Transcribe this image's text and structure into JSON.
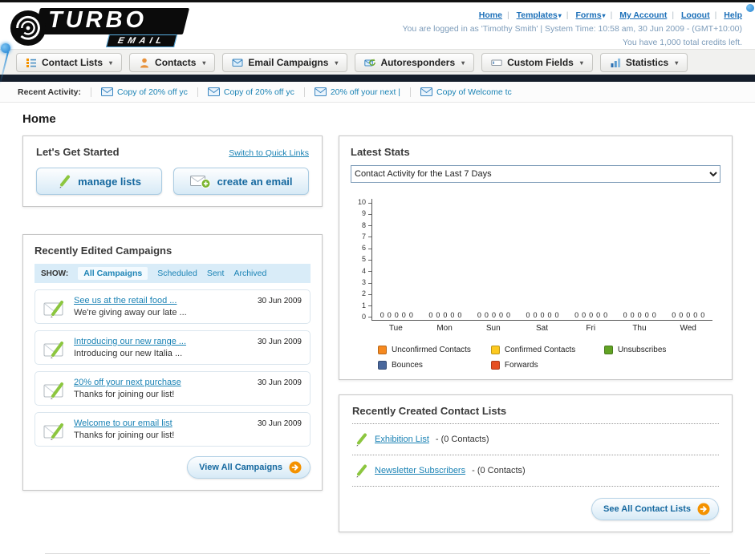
{
  "header": {
    "logo_word1": "TURBO",
    "logo_word2": "EMAIL",
    "links": {
      "home": "Home",
      "templates": "Templates",
      "forms": "Forms",
      "my_account": "My Account",
      "logout": "Logout",
      "help": "Help"
    },
    "login_info": "You are logged in as 'Timothy Smith' | System Time: 10:58 am, 30 Jun 2009 - (GMT+10:00)",
    "credits": "You have 1,000 total credits left."
  },
  "nav": {
    "tabs": [
      {
        "label": "Contact Lists"
      },
      {
        "label": "Contacts"
      },
      {
        "label": "Email Campaigns"
      },
      {
        "label": "Autoresponders"
      },
      {
        "label": "Custom Fields"
      },
      {
        "label": "Statistics"
      }
    ]
  },
  "recent_activity": {
    "label": "Recent Activity:",
    "items": [
      {
        "text": "Copy of 20% off yc"
      },
      {
        "text": "Copy of 20% off yc"
      },
      {
        "text": "20% off your next |"
      },
      {
        "text": "Copy of Welcome tc"
      }
    ]
  },
  "page_title": "Home",
  "get_started": {
    "title": "Let's Get Started",
    "switch_link": "Switch to Quick Links",
    "manage_lists": "manage lists",
    "create_email": "create an email"
  },
  "campaigns": {
    "title": "Recently Edited Campaigns",
    "show_label": "SHOW:",
    "filters": [
      {
        "label": "All Campaigns"
      },
      {
        "label": "Scheduled"
      },
      {
        "label": "Sent"
      },
      {
        "label": "Archived"
      }
    ],
    "items": [
      {
        "title": "See us at the retail food ...",
        "subtitle": "We're giving away our late ...",
        "date": "30 Jun 2009"
      },
      {
        "title": "Introducing our new range ...",
        "subtitle": "Introducing our new Italia ...",
        "date": "30 Jun 2009"
      },
      {
        "title": "20% off your next purchase",
        "subtitle": "Thanks for joining our list!",
        "date": "30 Jun 2009"
      },
      {
        "title": "Welcome to our email list",
        "subtitle": "Thanks for joining our list!",
        "date": "30 Jun 2009"
      }
    ],
    "view_all_label": "View All Campaigns"
  },
  "latest_stats": {
    "title": "Latest Stats",
    "selected_option": "Contact Activity for the Last 7 Days",
    "chart_data": {
      "type": "bar",
      "title": "Contact Activity for the Last 7 Days",
      "categories": [
        "Tue",
        "Mon",
        "Sun",
        "Sat",
        "Fri",
        "Thu",
        "Wed"
      ],
      "series": [
        {
          "name": "Unconfirmed Contacts",
          "color": "#f6891f",
          "values": [
            0,
            0,
            0,
            0,
            0,
            0,
            0
          ]
        },
        {
          "name": "Confirmed Contacts",
          "color": "#fdc91f",
          "values": [
            0,
            0,
            0,
            0,
            0,
            0,
            0
          ]
        },
        {
          "name": "Unsubscribes",
          "color": "#61a324",
          "values": [
            0,
            0,
            0,
            0,
            0,
            0,
            0
          ]
        },
        {
          "name": "Bounces",
          "color": "#49679c",
          "values": [
            0,
            0,
            0,
            0,
            0,
            0,
            0
          ]
        },
        {
          "name": "Forwards",
          "color": "#e64f22",
          "values": [
            0,
            0,
            0,
            0,
            0,
            0,
            0
          ]
        }
      ],
      "ylim": [
        0,
        10
      ],
      "grid": false,
      "legend_position": "bottom"
    }
  },
  "contact_lists": {
    "title": "Recently Created Contact Lists",
    "items": [
      {
        "name": "Exhibition List",
        "detail": "- (0 Contacts)"
      },
      {
        "name": "Newsletter Subscribers",
        "detail": "- (0 Contacts)"
      }
    ],
    "see_all_label": "See All Contact Lists"
  }
}
